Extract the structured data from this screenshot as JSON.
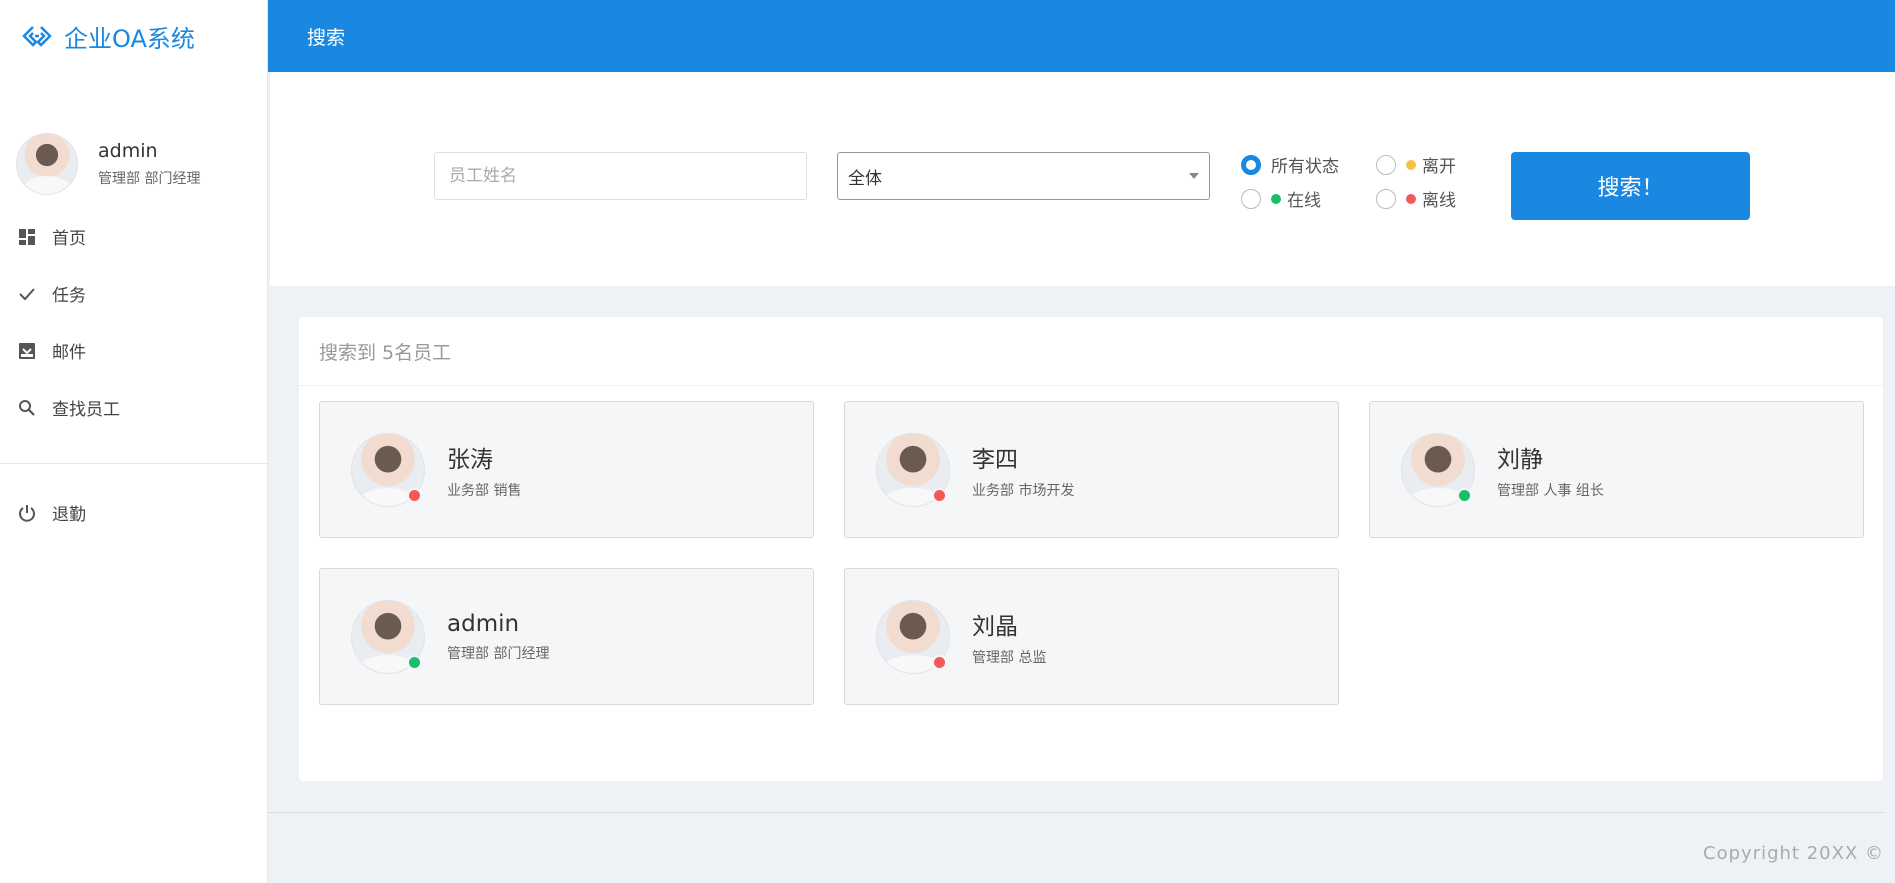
{
  "app": {
    "title": "企业OA系统",
    "logo_icon": "diamond-link-icon"
  },
  "user": {
    "name": "admin",
    "role": "管理部 部门经理"
  },
  "sidebar": {
    "items": [
      {
        "label": "首页",
        "icon": "dashboard-icon"
      },
      {
        "label": "任务",
        "icon": "check-icon"
      },
      {
        "label": "邮件",
        "icon": "inbox-icon"
      },
      {
        "label": "查找员工",
        "icon": "search-icon"
      }
    ],
    "logout": {
      "label": "退勤",
      "icon": "power-icon"
    }
  },
  "header": {
    "title": "搜索"
  },
  "search": {
    "name_placeholder": "员工姓名",
    "name_value": "",
    "dept_selected": "全体",
    "status_options": [
      {
        "label": "所有状态",
        "checked": true,
        "dot": ""
      },
      {
        "label": "离开",
        "checked": false,
        "dot": "#f5c242"
      },
      {
        "label": "在线",
        "checked": false,
        "dot": "#19be6b"
      },
      {
        "label": "离线",
        "checked": false,
        "dot": "#f25a5a"
      }
    ],
    "button_label": "搜索！"
  },
  "results": {
    "summary": "搜索到 5名员工",
    "employees": [
      {
        "name": "张涛",
        "meta": "业务部 销售",
        "status_color": "#f25a5a"
      },
      {
        "name": "李四",
        "meta": "业务部 市场开发",
        "status_color": "#f25a5a"
      },
      {
        "name": "刘静",
        "meta": "管理部 人事 组长",
        "status_color": "#19be6b"
      },
      {
        "name": "admin",
        "meta": "管理部 部门经理",
        "status_color": "#19be6b"
      },
      {
        "name": "刘晶",
        "meta": "管理部 总监",
        "status_color": "#f25a5a"
      }
    ]
  },
  "footer": {
    "copyright": "Copyright 20XX ©"
  },
  "colors": {
    "accent": "#1a88e0",
    "online": "#19be6b",
    "offline": "#f25a5a",
    "away": "#f5c242"
  }
}
